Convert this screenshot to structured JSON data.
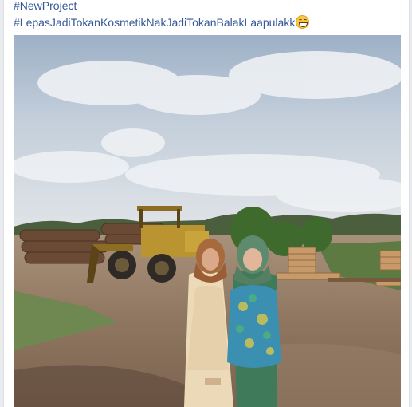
{
  "post": {
    "hashtags": [
      "#NewProject",
      "#LepasJadiTokanKosmetikNakJadiTokanBalakLaapulakk"
    ],
    "emoji": "grinning-squinting-face-emoji"
  },
  "photo": {
    "subject": "two-women-posing-at-logging-yard"
  }
}
